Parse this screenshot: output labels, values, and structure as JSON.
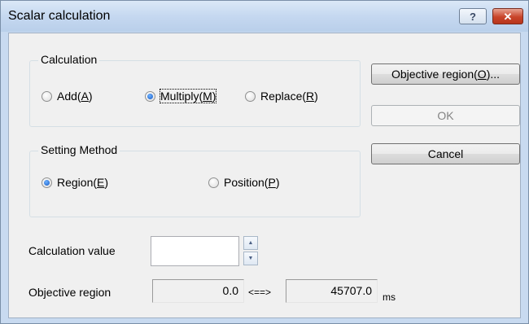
{
  "window": {
    "title": "Scalar calculation",
    "help_glyph": "?",
    "close_glyph": "✕"
  },
  "calculation": {
    "label": "Calculation",
    "options": [
      {
        "pre": "Add(",
        "key": "A",
        "post": ")",
        "selected": false
      },
      {
        "pre": "Multiply(",
        "key": "M",
        "post": ")",
        "selected": true
      },
      {
        "pre": "Replace(",
        "key": "R",
        "post": ")",
        "selected": false
      }
    ]
  },
  "setting_method": {
    "label": "Setting Method",
    "options": [
      {
        "pre": "Region(",
        "key": "E",
        "post": ")",
        "selected": true
      },
      {
        "pre": "Position(",
        "key": "P",
        "post": ")",
        "selected": false
      }
    ]
  },
  "buttons": {
    "objective_region": {
      "pre": "Objective region(",
      "key": "O",
      "post": ")..."
    },
    "ok": {
      "label": "OK",
      "enabled": false
    },
    "cancel": {
      "label": "Cancel"
    }
  },
  "calculation_value": {
    "label": "Calculation value",
    "value": ""
  },
  "objective_region": {
    "label": "Objective region",
    "start": "0.0",
    "separator": "<==>",
    "end": "45707.0",
    "unit": "ms"
  },
  "spinner": {
    "up_glyph": "▲",
    "down_glyph": "▼"
  }
}
